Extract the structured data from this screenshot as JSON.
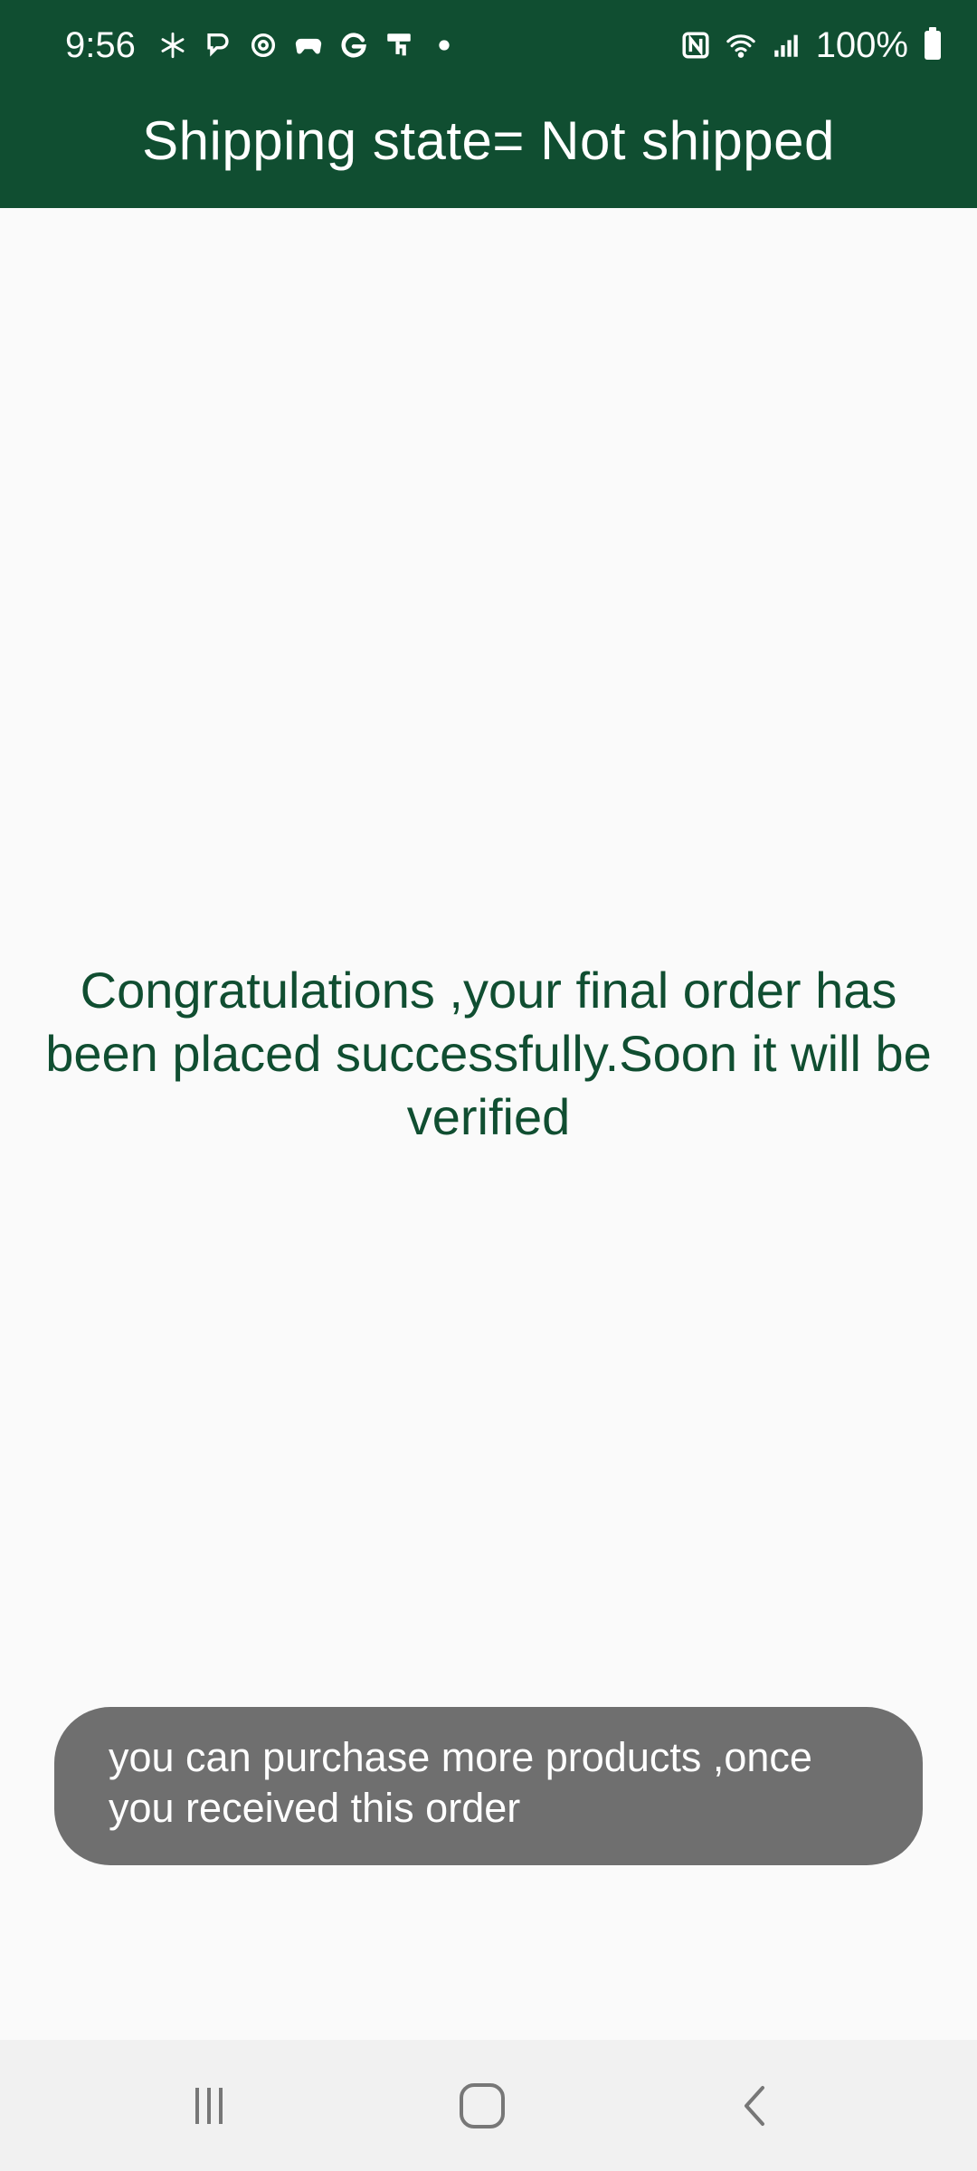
{
  "status_bar": {
    "time": "9:56",
    "notification_icons": [
      "snowflake-icon",
      "messenger-icon",
      "target-icon",
      "gamepad-icon",
      "google-icon",
      "touch-icon",
      "dot-icon"
    ],
    "battery": "100%"
  },
  "app_bar": {
    "title": "Shipping state= Not shipped"
  },
  "main": {
    "message": "Congratulations ,your final order has been placed successfully.Soon it will be verified"
  },
  "toast": {
    "text": "you can purchase more products ,once you received this order"
  },
  "colors": {
    "primary": "#104e31",
    "toast_bg": "#6f6f6f",
    "background": "#fafafa"
  },
  "navigation": {
    "buttons": [
      "recent-apps",
      "home",
      "back"
    ]
  }
}
